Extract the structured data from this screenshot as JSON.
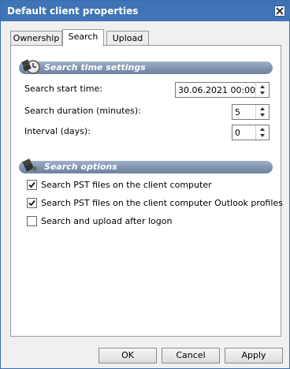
{
  "window": {
    "title": "Default client properties"
  },
  "tabs": [
    {
      "label": "Ownership"
    },
    {
      "label": "Search"
    },
    {
      "label": "Upload"
    }
  ],
  "search_time": {
    "section_title": "Search time settings",
    "start_time_label": "Search start time:",
    "start_time_value": "30.06.2021 00:00",
    "duration_label": "Search duration (minutes):",
    "duration_value": "5",
    "interval_label": "Interval (days):",
    "interval_value": "0"
  },
  "search_options": {
    "section_title": "Search options",
    "options": [
      {
        "label": "Search PST files on the client computer",
        "checked": true
      },
      {
        "label": "Search PST files on the client computer Outlook profiles",
        "checked": true
      },
      {
        "label": "Search and upload after logon",
        "checked": false
      }
    ]
  },
  "buttons": {
    "ok": "OK",
    "cancel": "Cancel",
    "apply": "Apply"
  },
  "colors": {
    "titlebar": "#3f74b6",
    "section_bar": "#7d90ab"
  }
}
